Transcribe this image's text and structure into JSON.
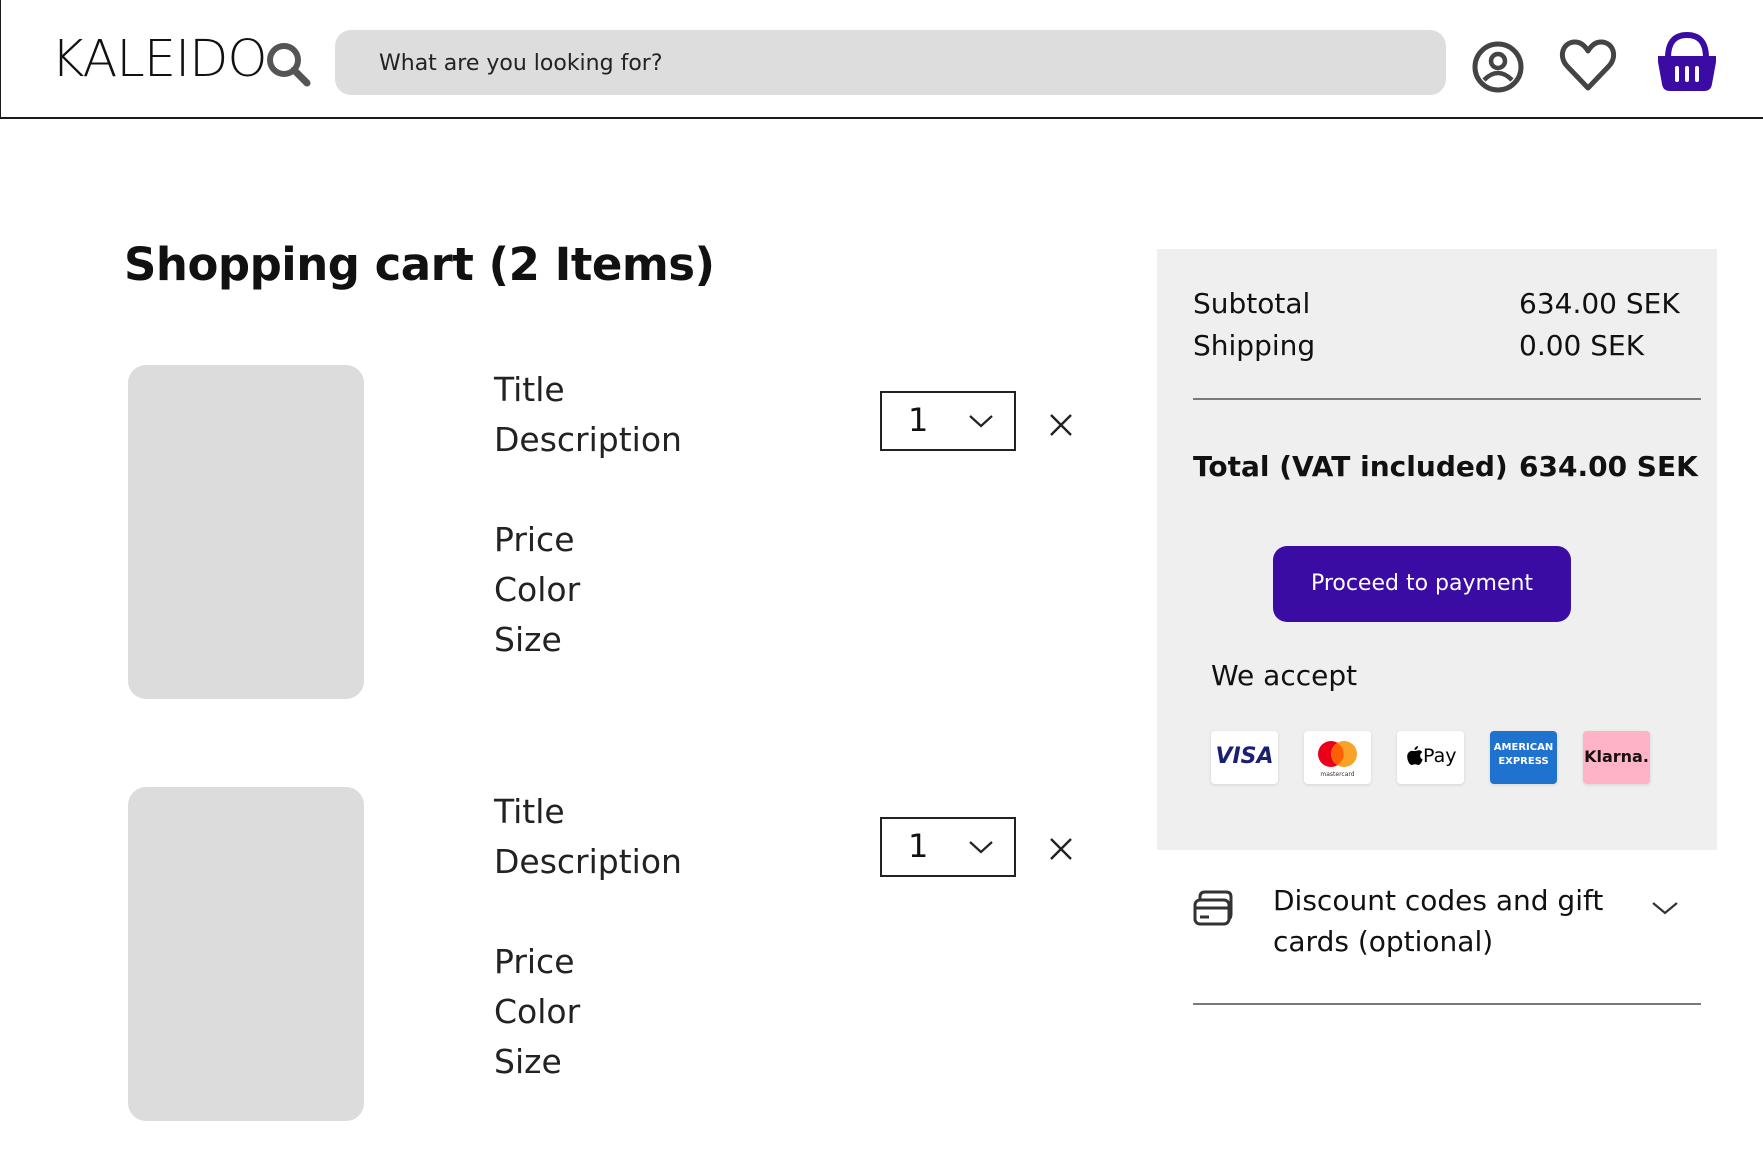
{
  "header": {
    "logo": "KALEIDO",
    "search_placeholder": "What are you looking for?"
  },
  "icons": {
    "search": "search-icon",
    "account": "user-circle-icon",
    "wishlist": "heart-icon",
    "basket": "basket-icon",
    "remove": "close-icon",
    "dropdown": "chevron-down-icon",
    "gift_card": "gift-card-icon"
  },
  "colors": {
    "accent": "#3a0ca3",
    "placeholder_gray": "#dcdcdc",
    "panel_bg": "#efefef",
    "search_bg": "#dddddd"
  },
  "cart": {
    "title": "Shopping cart (2 Items)",
    "items": [
      {
        "title": "Title",
        "description": "Description",
        "price": "Price",
        "color": "Color",
        "size": "Size",
        "quantity": "1"
      },
      {
        "title": "Title",
        "description": "Description",
        "price": "Price",
        "color": "Color",
        "size": "Size",
        "quantity": "1"
      }
    ]
  },
  "summary": {
    "subtotal_label": "Subtotal",
    "subtotal_value": "634.00 SEK",
    "shipping_label": "Shipping",
    "shipping_value": "0.00 SEK",
    "total_label": "Total (VAT included)",
    "total_value": "634.00 SEK",
    "pay_button": "Proceed to payment",
    "accept_label": "We accept",
    "payment_methods": [
      "VISA",
      "mastercard",
      "Pay",
      "AMERICAN EXPRESS",
      "Klarna."
    ]
  },
  "discount": {
    "label": "Discount codes and gift cards (optional)"
  }
}
